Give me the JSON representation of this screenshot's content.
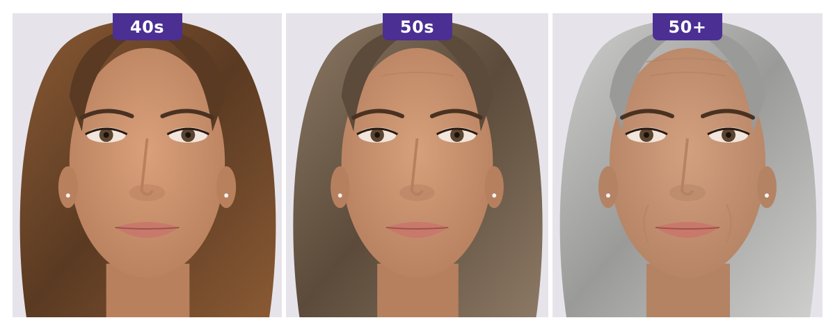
{
  "panels": [
    {
      "label": "40s",
      "hair_color": "#5a3a22",
      "hair_highlight": "#8a5a34",
      "skin_color": "#d9a07a",
      "skin_shadow": "#b9805e"
    },
    {
      "label": "50s",
      "hair_color": "#5c4a3a",
      "hair_highlight": "#8c7a66",
      "skin_color": "#d6a07c",
      "skin_shadow": "#b6805f"
    },
    {
      "label": "50+",
      "hair_color": "#9a9a98",
      "hair_highlight": "#cfcfcd",
      "skin_color": "#d3a07f",
      "skin_shadow": "#b48364"
    }
  ],
  "colors": {
    "badge": "#4b2f93",
    "background": "#e6e4ea",
    "lips": "#c8796c",
    "iris": "#5b4530"
  }
}
